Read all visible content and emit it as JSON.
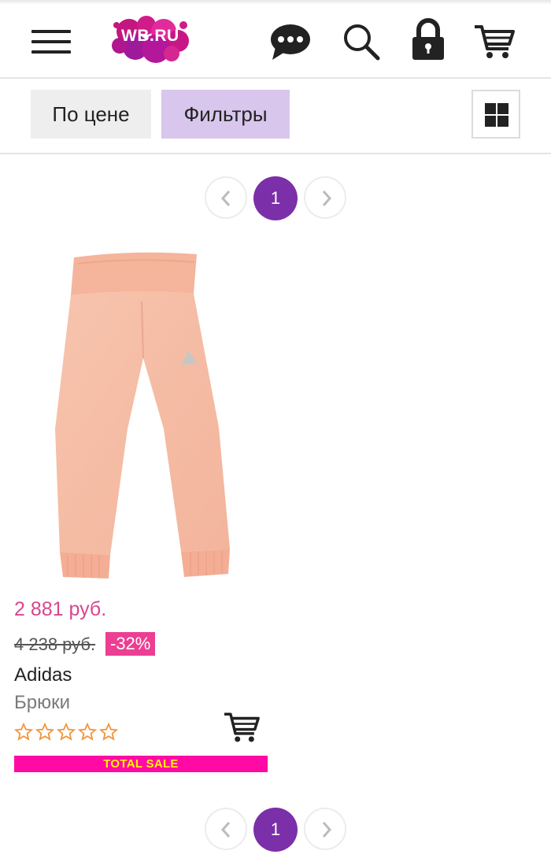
{
  "header": {
    "logo_text": "WB.RU",
    "icons": [
      "menu-icon",
      "chat-icon",
      "search-icon",
      "lock-icon",
      "cart-icon"
    ]
  },
  "filters": {
    "sort_label": "По цене",
    "filter_label": "Фильтры",
    "view_icon": "grid-icon"
  },
  "pagination": {
    "current_page": "1"
  },
  "product": {
    "price": "2 881 руб.",
    "old_price": "4 238 руб.",
    "discount": "-32%",
    "brand": "Adidas",
    "type": "Брюки",
    "rating": 0,
    "rating_max": 5,
    "sale_banner": "TOTAL SALE",
    "image_icon": "pants-image"
  },
  "colors": {
    "accent_purple": "#7b2fa8",
    "filter_active_bg": "#d8c6ec",
    "price_pink": "#d9468f",
    "discount_pink": "#ec3e92",
    "sale_banner_bg": "#ff0aa5",
    "sale_banner_text": "#fff500",
    "star_orange": "#f0963c"
  }
}
